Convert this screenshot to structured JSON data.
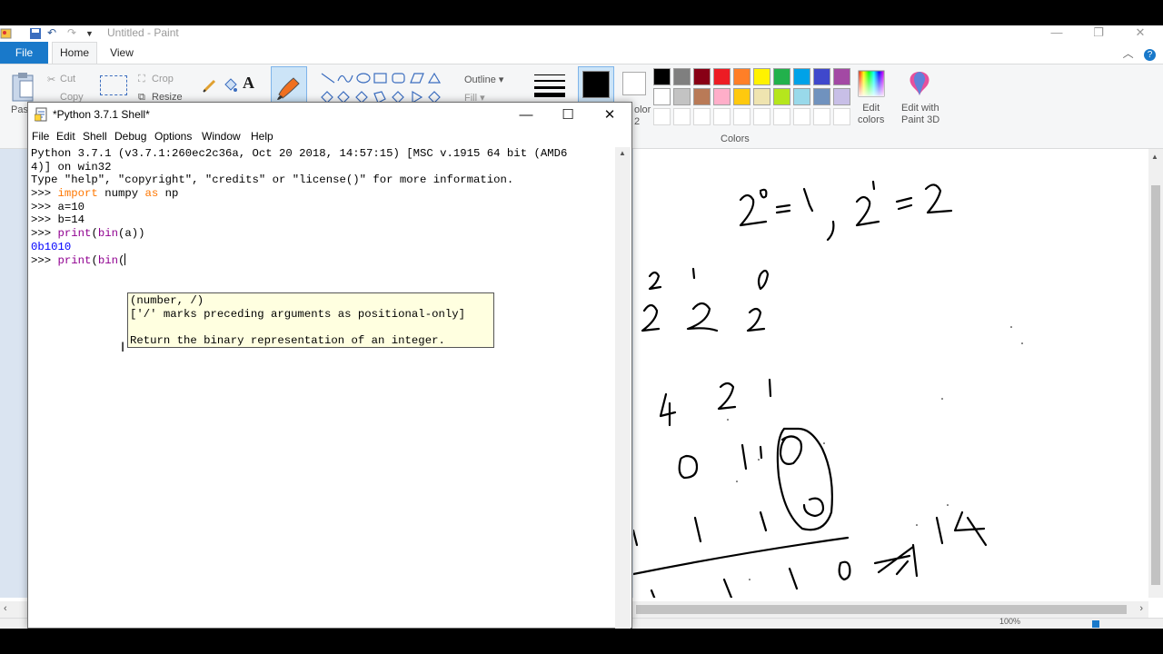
{
  "paint": {
    "title": "Untitled - Paint",
    "tabs": {
      "file": "File",
      "home": "Home",
      "view": "View"
    },
    "ribbon": {
      "paste": "Past",
      "cut": "Cut",
      "copy": "Copy",
      "crop": "Crop",
      "resize": "Resize",
      "outline": "Outline",
      "fill": "Fill",
      "color2_fragment": "olor\n2",
      "edit_colors": "Edit\ncolors",
      "edit_paint3d": "Edit with\nPaint 3D",
      "colors_group": "Colors"
    },
    "palette_row1": [
      "#000000",
      "#7f7f7f",
      "#880015",
      "#ed1c24",
      "#ff7f27",
      "#fff200",
      "#22b14c",
      "#00a2e8",
      "#3f48cc",
      "#a349a4"
    ],
    "palette_row2": [
      "#ffffff",
      "#c3c3c3",
      "#b97a57",
      "#ffaec9",
      "#ffc90e",
      "#efe4b0",
      "#b5e61d",
      "#99d9ea",
      "#7092be",
      "#c8bfe7"
    ],
    "status_zoom": "100%"
  },
  "idle": {
    "title": "*Python 3.7.1 Shell*",
    "menu": [
      "File",
      "Edit",
      "Shell",
      "Debug",
      "Options",
      "Window",
      "Help"
    ],
    "banner1": "Python 3.7.1 (v3.7.1:260ec2c36a, Oct 20 2018, 14:57:15) [MSC v.1915 64 bit (AMD6",
    "banner2": "4)] on win32",
    "banner3": "Type \"help\", \"copyright\", \"credits\" or \"license()\" for more information.",
    "prompt": ">>> ",
    "lines": {
      "import_kw": "import",
      "import_mod": " numpy ",
      "as_kw": "as",
      "import_alias": " np",
      "a_assign": "a=10",
      "b_assign": "b=14",
      "print1_fn": "print",
      "print1_rest_a": "(",
      "print1_bin": "bin",
      "print1_rest_b": "(a))",
      "output1": "0b1010",
      "print2_fn": "print",
      "print2_rest_a": "(",
      "print2_bin": "bin",
      "print2_rest_b": "("
    },
    "calltip": {
      "signature": "(number, /)",
      "note": "['/' marks preceding arguments as positional-only]",
      "doc": "Return the binary representation of an integer."
    }
  }
}
